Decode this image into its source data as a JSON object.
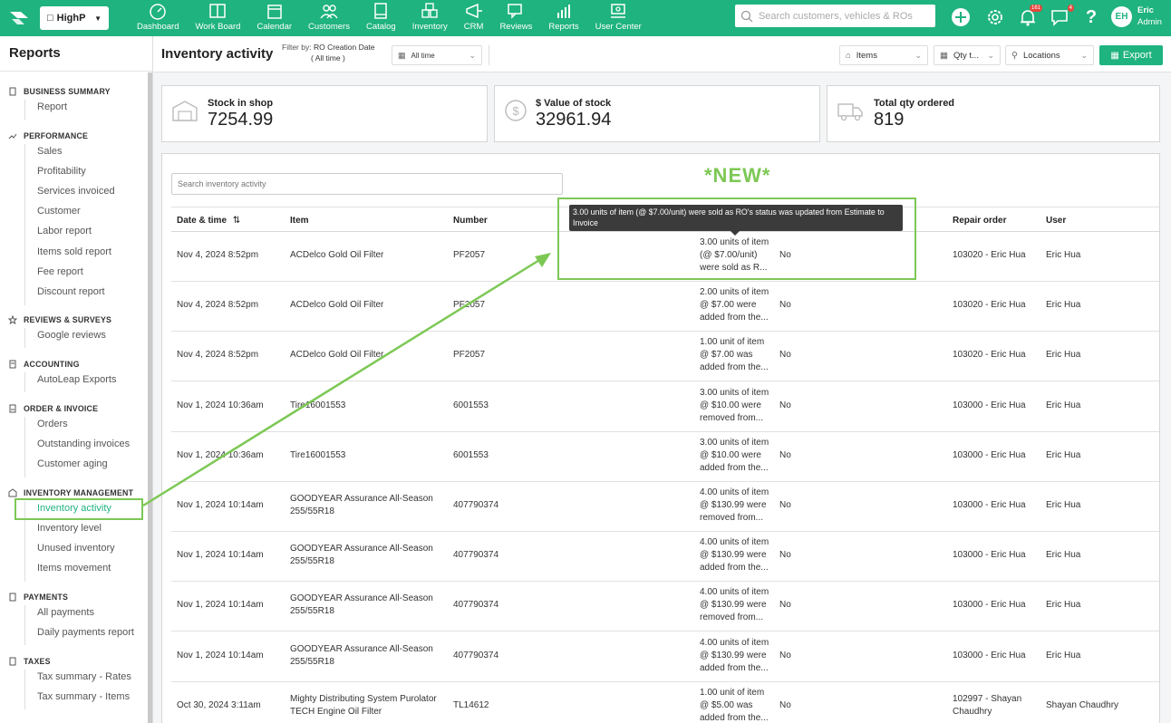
{
  "topnav": {
    "shop": "HighP",
    "items": [
      "Dashboard",
      "Work Board",
      "Calendar",
      "Customers",
      "Catalog",
      "Inventory",
      "CRM",
      "Reviews",
      "Reports",
      "User Center"
    ],
    "search_placeholder": "Search customers, vehicles & ROs",
    "notifications_count": "161",
    "messages_count": "4",
    "avatar_initials": "EH",
    "user_name": "Eric",
    "user_role": "Admin",
    "accent_color": "#1fb37f"
  },
  "sidebar": {
    "title": "Reports",
    "sections": [
      {
        "label": "BUSINESS SUMMARY",
        "icon": "document-icon",
        "items": [
          "Report"
        ]
      },
      {
        "label": "PERFORMANCE",
        "icon": "chart-icon",
        "items": [
          "Sales",
          "Profitability",
          "Services invoiced",
          "Customer",
          "Labor report",
          "Items sold report",
          "Fee report",
          "Discount report"
        ]
      },
      {
        "label": "REVIEWS & SURVEYS",
        "icon": "star-icon",
        "items": [
          "Google reviews"
        ]
      },
      {
        "label": "ACCOUNTING",
        "icon": "ledger-icon",
        "items": [
          "AutoLeap Exports"
        ]
      },
      {
        "label": "ORDER & INVOICE",
        "icon": "invoice-icon",
        "items": [
          "Orders",
          "Outstanding invoices",
          "Customer aging"
        ]
      },
      {
        "label": "INVENTORY MANAGEMENT",
        "icon": "warehouse-icon",
        "items": [
          "Inventory activity",
          "Inventory level",
          "Unused inventory",
          "Items movement"
        ]
      },
      {
        "label": "PAYMENTS",
        "icon": "payment-icon",
        "items": [
          "All payments",
          "Daily payments report"
        ]
      },
      {
        "label": "TAXES",
        "icon": "tax-icon",
        "items": [
          "Tax summary - Rates",
          "Tax summary - Items"
        ]
      }
    ]
  },
  "header": {
    "title": "Inventory activity",
    "filter_label": "Filter by:",
    "filter_value": "RO Creation Date",
    "filter_range": "( All time )",
    "date_dropdown": "All time",
    "items_dropdown": "Items",
    "qty_dropdown": "Qty t...",
    "locations_dropdown": "Locations",
    "export_label": "Export"
  },
  "stats": [
    {
      "label": "Stock in shop",
      "value": "7254.99",
      "icon": "warehouse-icon"
    },
    {
      "label": "$ Value of stock",
      "value": "32961.94",
      "icon": "dollar-icon"
    },
    {
      "label": "Total qty ordered",
      "value": "819",
      "icon": "truck-icon"
    }
  ],
  "table": {
    "search_placeholder": "Search inventory activity",
    "new_label": "*NEW*",
    "columns": [
      "Date & time",
      "Item",
      "Number",
      "Repair order",
      "User"
    ],
    "tooltip": "3.00 units of item (@ $7.00/unit) were sold as RO's status was updated from Estimate to Invoice",
    "rows": [
      {
        "date": "Nov 4, 2024 8:52pm",
        "item": [
          "ACDelco Gold Oil Filter"
        ],
        "number": "PF2057",
        "desc": [
          "3.00 units of item",
          "(@ $7.00/unit)",
          "were sold as R..."
        ],
        "flag": "No",
        "ro": [
          "103020 - Eric Hua"
        ],
        "user": "Eric Hua"
      },
      {
        "date": "Nov 4, 2024 8:52pm",
        "item": [
          "ACDelco Gold Oil Filter"
        ],
        "number": "PF2057",
        "desc": [
          "2.00 units of item",
          "@ $7.00 were",
          "added from the..."
        ],
        "flag": "No",
        "ro": [
          "103020 - Eric Hua"
        ],
        "user": "Eric Hua"
      },
      {
        "date": "Nov 4, 2024 8:52pm",
        "item": [
          "ACDelco Gold Oil Filter"
        ],
        "number": "PF2057",
        "desc": [
          "1.00 unit of item",
          "@ $7.00 was",
          "added from the..."
        ],
        "flag": "No",
        "ro": [
          "103020 - Eric Hua"
        ],
        "user": "Eric Hua"
      },
      {
        "date": "Nov 1, 2024 10:36am",
        "item": [
          "Tire16001553"
        ],
        "number": "6001553",
        "desc": [
          "3.00 units of item",
          "@ $10.00 were",
          "removed from..."
        ],
        "flag": "No",
        "ro": [
          "103000 - Eric Hua"
        ],
        "user": "Eric Hua"
      },
      {
        "date": "Nov 1, 2024 10:36am",
        "item": [
          "Tire16001553"
        ],
        "number": "6001553",
        "desc": [
          "3.00 units of item",
          "@ $10.00 were",
          "added from the..."
        ],
        "flag": "No",
        "ro": [
          "103000 - Eric Hua"
        ],
        "user": "Eric Hua"
      },
      {
        "date": "Nov 1, 2024 10:14am",
        "item": [
          "GOODYEAR Assurance All-Season",
          "255/55R18"
        ],
        "number": "407790374",
        "desc": [
          "4.00 units of item",
          "@ $130.99 were",
          "removed from..."
        ],
        "flag": "No",
        "ro": [
          "103000 - Eric Hua"
        ],
        "user": "Eric Hua"
      },
      {
        "date": "Nov 1, 2024 10:14am",
        "item": [
          "GOODYEAR Assurance All-Season",
          "255/55R18"
        ],
        "number": "407790374",
        "desc": [
          "4.00 units of item",
          "@ $130.99 were",
          "added from the..."
        ],
        "flag": "No",
        "ro": [
          "103000 - Eric Hua"
        ],
        "user": "Eric Hua"
      },
      {
        "date": "Nov 1, 2024 10:14am",
        "item": [
          "GOODYEAR Assurance All-Season",
          "255/55R18"
        ],
        "number": "407790374",
        "desc": [
          "4.00 units of item",
          "@ $130.99 were",
          "removed from..."
        ],
        "flag": "No",
        "ro": [
          "103000 - Eric Hua"
        ],
        "user": "Eric Hua"
      },
      {
        "date": "Nov 1, 2024 10:14am",
        "item": [
          "GOODYEAR Assurance All-Season",
          "255/55R18"
        ],
        "number": "407790374",
        "desc": [
          "4.00 units of item",
          "@ $130.99 were",
          "added from the..."
        ],
        "flag": "No",
        "ro": [
          "103000 - Eric Hua"
        ],
        "user": "Eric Hua"
      },
      {
        "date": "Oct 30, 2024 3:11am",
        "item": [
          "Mighty Distributing System Purolator",
          "TECH Engine Oil Filter"
        ],
        "number": "TL14612",
        "desc": [
          "1.00 unit of item",
          "@ $5.00 was",
          "added from the..."
        ],
        "flag": "No",
        "ro": [
          "102997 - Shayan",
          "Chaudhry"
        ],
        "user": "Shayan Chaudhry"
      }
    ]
  },
  "highlight_color": "#7dc855"
}
